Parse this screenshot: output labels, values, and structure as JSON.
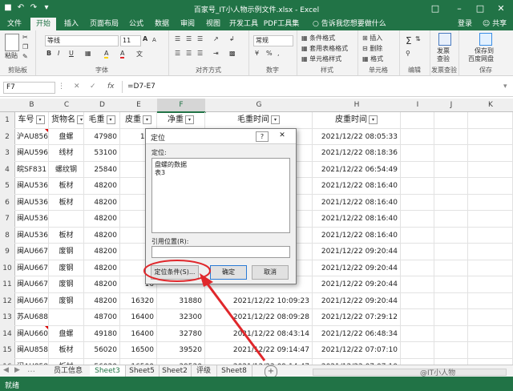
{
  "window": {
    "title": "百家号_IT小人物示例文件.xlsx - Excel",
    "login": "登录",
    "share": "共享"
  },
  "tabs": [
    "文件",
    "开始",
    "插入",
    "页面布局",
    "公式",
    "数据",
    "审阅",
    "视图",
    "开发工具",
    "PDF工具集"
  ],
  "active_tab": "开始",
  "tell_me": "告诉我您想要做什么",
  "ribbon": {
    "clipboard": {
      "paste": "粘贴",
      "label": "剪贴板"
    },
    "font": {
      "name": "等线",
      "size": "11",
      "bold": "B",
      "italic": "I",
      "underline": "U",
      "grow": "A",
      "shrink": "A",
      "fill": "A",
      "color": "A",
      "wen": "文",
      "label": "字体"
    },
    "align": {
      "label": "对齐方式"
    },
    "number": {
      "format": "常规",
      "label": "数字"
    },
    "styles": {
      "cond": "条件格式",
      "table": "套用表格格式",
      "cell": "单元格样式",
      "label": "样式"
    },
    "cells": {
      "insert": "插入",
      "delete": "删除",
      "format": "格式",
      "label": "单元格"
    },
    "editing": {
      "label": "编辑"
    },
    "invoice": {
      "btn1": "发票",
      "btn2": "查验",
      "label": "发票查验"
    },
    "save": {
      "line1": "保存到",
      "line2": "百度网盘",
      "label": "保存"
    }
  },
  "formula_bar": {
    "name_box": "F7",
    "fx": "fx",
    "formula": "=D7-E7"
  },
  "columns": [
    "B",
    "C",
    "D",
    "E",
    "F",
    "G",
    "H",
    "I",
    "J",
    "K"
  ],
  "selected_column": "F",
  "header_row": [
    "车号",
    "货物名",
    "毛重",
    "皮重",
    "净重",
    "毛重时间",
    "皮重时间"
  ],
  "filter_glyph": "▾",
  "rows": [
    {
      "n": "2",
      "b": "沪AU856",
      "c": "盘螺",
      "d": "47980",
      "e": "160",
      "f": "",
      "g": "",
      "h": "2021/12/22 08:05:33"
    },
    {
      "n": "3",
      "b": "闽AU596",
      "c": "线材",
      "d": "53100",
      "e": "16",
      "f": "",
      "g": "",
      "h": "2021/12/22 08:18:36"
    },
    {
      "n": "4",
      "b": "皖SF831",
      "c": "螺纹钢",
      "d": "25840",
      "e": "16",
      "f": "",
      "g": "",
      "h": "2021/12/22 06:54:49"
    },
    {
      "n": "5",
      "b": "闽AU536",
      "c": "板材",
      "d": "48200",
      "e": "16",
      "f": "",
      "g": "",
      "h": "2021/12/22 08:16:40"
    },
    {
      "n": "6",
      "b": "闽AU536",
      "c": "板材",
      "d": "48200",
      "e": "16",
      "f": "",
      "g": "",
      "h": "2021/12/22 08:16:40"
    },
    {
      "n": "7",
      "b": "闽AU536",
      "c": "",
      "d": "48200",
      "e": "16",
      "f": "",
      "g": "",
      "h": "2021/12/22 08:16:40"
    },
    {
      "n": "8",
      "b": "闽AU536",
      "c": "板材",
      "d": "48200",
      "e": "16",
      "f": "",
      "g": "",
      "h": "2021/12/22 08:16:40"
    },
    {
      "n": "9",
      "b": "闽AU667",
      "c": "废钢",
      "d": "48200",
      "e": "16",
      "f": "",
      "g": "",
      "h": "2021/12/22 09:20:44"
    },
    {
      "n": "10",
      "b": "闽AU667",
      "c": "废钢",
      "d": "48200",
      "e": "16",
      "f": "",
      "g": "",
      "h": "2021/12/22 09:20:44"
    },
    {
      "n": "11",
      "b": "闽AU667",
      "c": "废钢",
      "d": "48200",
      "e": "16",
      "f": "",
      "g": "",
      "h": "2021/12/22 09:20:44"
    },
    {
      "n": "12",
      "b": "闽AU667",
      "c": "废钢",
      "d": "48200",
      "e": "16320",
      "f": "31880",
      "g": "2021/12/22 10:09:23",
      "h": "2021/12/22 09:20:44"
    },
    {
      "n": "13",
      "b": "苏AU688",
      "c": "",
      "d": "48700",
      "e": "16400",
      "f": "32300",
      "g": "2021/12/22 08:09:28",
      "h": "2021/12/22 07:29:12"
    },
    {
      "n": "14",
      "b": "闽AU660",
      "c": "盘螺",
      "d": "49180",
      "e": "16400",
      "f": "32780",
      "g": "2021/12/22 08:43:14",
      "h": "2021/12/22 06:48:34"
    },
    {
      "n": "15",
      "b": "闽AU858",
      "c": "板材",
      "d": "56020",
      "e": "16500",
      "f": "39520",
      "g": "2021/12/22 09:14:47",
      "h": "2021/12/22 07:07:10"
    },
    {
      "n": "16",
      "b": "闽AU858",
      "c": "板材",
      "d": "56020",
      "e": "16500",
      "f": "39520",
      "g": "2021/12/22 09:14:47",
      "h": "2021/12/22 07:07:10"
    }
  ],
  "dialog": {
    "title": "定位",
    "help": "?",
    "close": "✕",
    "goto_label": "定位:",
    "list_items": [
      "盘螺的数据",
      "表3"
    ],
    "reference_label": "引用位置(R):",
    "reference_value": "",
    "special_button": "定位条件(S)...",
    "ok_button": "确定",
    "cancel_button": "取消"
  },
  "sheets": [
    "员工信息",
    "Sheet3",
    "Sheet5",
    "Sheet2",
    "评级",
    "Sheet8"
  ],
  "active_sheet": "Sheet3",
  "status": {
    "ready": "就绪"
  },
  "watermark": "@IT小人物",
  "colors": {
    "excel_green": "#217346",
    "annotation_red": "#e0272b"
  }
}
